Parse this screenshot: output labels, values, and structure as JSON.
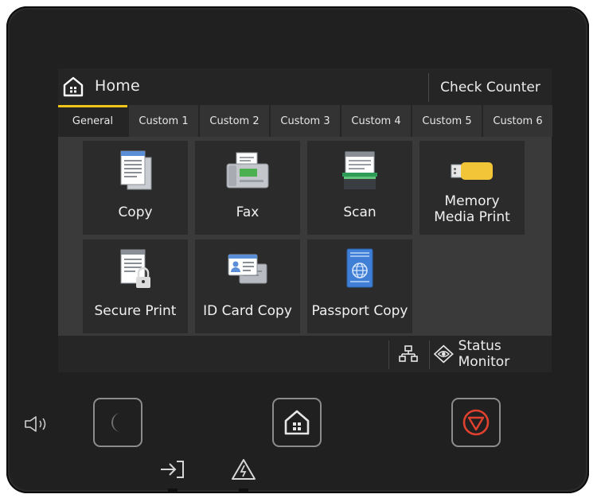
{
  "header": {
    "home_label": "Home",
    "check_counter_label": "Check Counter"
  },
  "tabs": [
    {
      "label": "General",
      "active": true
    },
    {
      "label": "Custom 1",
      "active": false
    },
    {
      "label": "Custom 2",
      "active": false
    },
    {
      "label": "Custom 3",
      "active": false
    },
    {
      "label": "Custom 4",
      "active": false
    },
    {
      "label": "Custom 5",
      "active": false
    },
    {
      "label": "Custom 6",
      "active": false
    }
  ],
  "tiles": [
    {
      "label": "Copy",
      "icon": "copy-icon"
    },
    {
      "label": "Fax",
      "icon": "fax-icon"
    },
    {
      "label": "Scan",
      "icon": "scan-icon"
    },
    {
      "label_line1": "Memory",
      "label_line2": "Media Print",
      "icon": "usb-memory-icon"
    },
    {
      "label": "Secure Print",
      "icon": "secure-print-icon"
    },
    {
      "label": "ID Card Copy",
      "icon": "id-card-icon"
    },
    {
      "label": "Passport Copy",
      "icon": "passport-icon"
    }
  ],
  "bottom_bar": {
    "network_icon": "network-icon",
    "status_monitor_label": "Status Monitor",
    "status_monitor_icon": "eye-icon"
  },
  "hardware": {
    "energy_saver_icon": "moon-icon",
    "home_button_icon": "home-icon",
    "stop_button_icon": "stop-icon",
    "sound_icon": "speaker-icon",
    "data_indicator_icon": "data-arrow-icon",
    "error_indicator_icon": "warning-icon"
  },
  "colors": {
    "accent_tab": "#f0c419",
    "stop_red": "#e0412f",
    "screen_bg": "#252525"
  }
}
